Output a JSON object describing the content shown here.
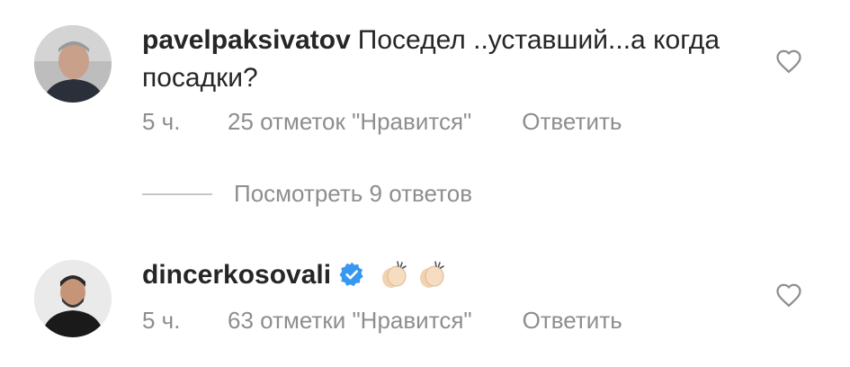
{
  "comments": [
    {
      "username": "pavelpaksivatov",
      "text": "Поседел ..уставший...а когда посадки?",
      "time": "5 ч.",
      "likes": "25 отметок \"Нравится\"",
      "reply": "Ответить",
      "verified": false
    },
    {
      "username": "dincerkosovali",
      "text": "👏🏻👏🏻",
      "time": "5 ч.",
      "likes": "63 отметки \"Нравится\"",
      "reply": "Ответить",
      "verified": true
    }
  ],
  "view_replies": "Посмотреть 9 ответов",
  "colors": {
    "text": "#262626",
    "secondary": "#8e8e8e",
    "verified": "#3897f0"
  }
}
